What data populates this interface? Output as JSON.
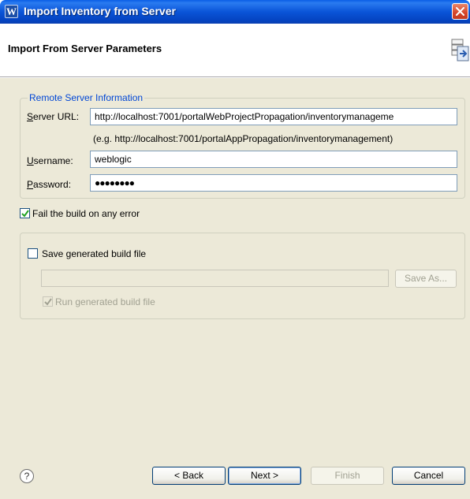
{
  "window": {
    "title": "Import Inventory from Server",
    "app_icon_glyph": "W"
  },
  "banner": {
    "heading": "Import From Server Parameters"
  },
  "remote_server": {
    "legend": "Remote Server Information",
    "server_url_label": "Server URL:",
    "server_url_value": "http://localhost:7001/portalWebProjectPropagation/inventorymanageme",
    "server_url_hint": "(e.g. http://localhost:7001/portalAppPropagation/inventorymanagement)",
    "username_label": "Username:",
    "username_value": "weblogic",
    "password_label": "Password:",
    "password_value": "●●●●●●●●"
  },
  "fail_build": {
    "label": "Fail the build on any error",
    "checked": true
  },
  "build_file": {
    "save_label": "Save generated build file",
    "save_checked": false,
    "path_value": "",
    "save_as_label": "Save As...",
    "run_label": "Run generated build file",
    "run_checked": true
  },
  "buttons": {
    "help_glyph": "?",
    "back_label": "< Back",
    "next_label": "Next >",
    "finish_label": "Finish",
    "cancel_label": "Cancel"
  },
  "colors": {
    "titlebar": "#0a54d8",
    "legend": "#0046d5",
    "dialog_bg": "#ece9d8"
  }
}
